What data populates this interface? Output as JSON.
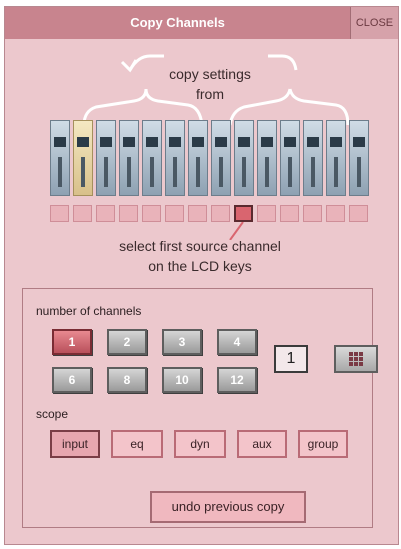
{
  "window": {
    "title": "Copy Channels",
    "close_label": "CLOSE"
  },
  "diagram": {
    "copy_line1": "copy settings",
    "copy_line2": "from",
    "select_line1": "select first source channel",
    "select_line2": "on the LCD keys"
  },
  "channels": {
    "label": "number of channels",
    "buttons": [
      "1",
      "2",
      "3",
      "4",
      "6",
      "8",
      "10",
      "12"
    ],
    "selected": "1",
    "count_display": "1"
  },
  "scope": {
    "label": "scope",
    "buttons": [
      "input",
      "eq",
      "dyn",
      "aux",
      "group"
    ],
    "active": "input"
  },
  "actions": {
    "undo_label": "undo previous copy"
  },
  "colors": {
    "panel": "#ecc8cd",
    "titlebar": "#c8848e",
    "active_button": "#b9505b"
  },
  "icons": {
    "grid": "keypad-grid-icon"
  }
}
